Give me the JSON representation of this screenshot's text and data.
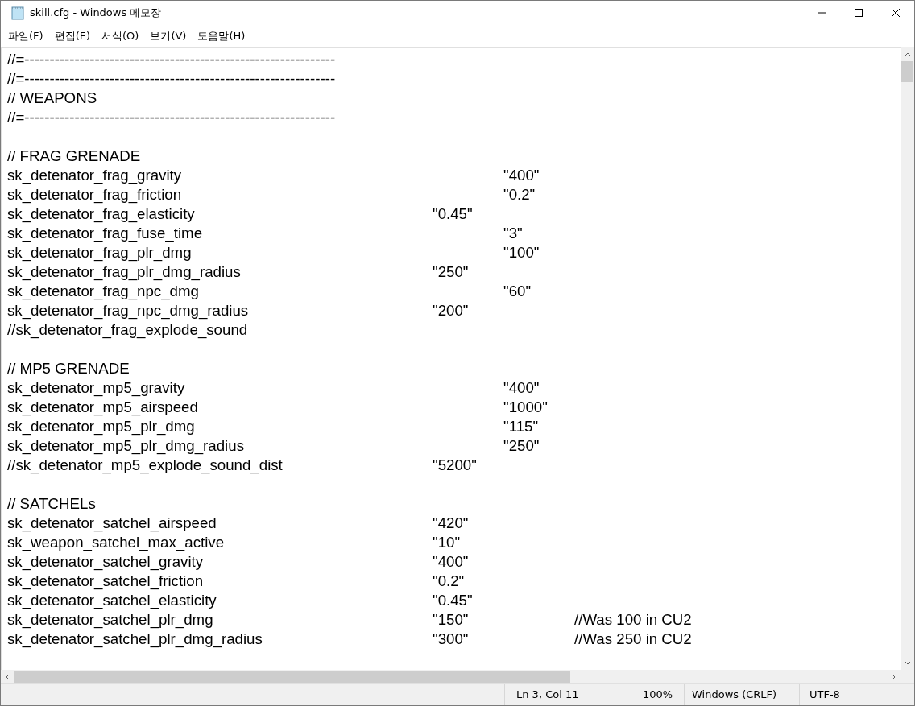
{
  "window": {
    "title": "skill.cfg - Windows 메모장"
  },
  "menu": [
    "파일(F)",
    "편집(E)",
    "서식(O)",
    "보기(V)",
    "도움말(H)"
  ],
  "editor": {
    "lines": [
      {
        "kind": "text",
        "text": "//=--------------------------------------------------------------"
      },
      {
        "kind": "text",
        "text": "//=--------------------------------------------------------------"
      },
      {
        "kind": "text",
        "text": "// WEAPONS"
      },
      {
        "kind": "text",
        "text": "//=--------------------------------------------------------------"
      },
      {
        "kind": "blank"
      },
      {
        "kind": "text",
        "text": "// FRAG GRENADE"
      },
      {
        "kind": "text",
        "text": "sk_detenator_frag_gravity\t\t\t\t\t\"400\""
      },
      {
        "kind": "text",
        "text": "sk_detenator_frag_friction\t\t\t\t\t\"0.2\""
      },
      {
        "kind": "text",
        "text": "sk_detenator_frag_elasticity\t\t\t\t\"0.45\""
      },
      {
        "kind": "text",
        "text": "sk_detenator_frag_fuse_time\t\t\t\t\t\"3\""
      },
      {
        "kind": "text",
        "text": "sk_detenator_frag_plr_dmg\t\t\t\t\t\"100\""
      },
      {
        "kind": "text",
        "text": "sk_detenator_frag_plr_dmg_radius\t\t\t\"250\""
      },
      {
        "kind": "text",
        "text": "sk_detenator_frag_npc_dmg\t\t\t\t\t\"60\""
      },
      {
        "kind": "text",
        "text": "sk_detenator_frag_npc_dmg_radius\t\t\t\"200\""
      },
      {
        "kind": "text",
        "text": "//sk_detenator_frag_explode_sound"
      },
      {
        "kind": "blank"
      },
      {
        "kind": "text",
        "text": "// MP5 GRENADE"
      },
      {
        "kind": "text",
        "text": "sk_detenator_mp5_gravity\t\t\t\t\t\"400\""
      },
      {
        "kind": "text",
        "text": "sk_detenator_mp5_airspeed\t\t\t\t\t\"1000\""
      },
      {
        "kind": "text",
        "text": "sk_detenator_mp5_plr_dmg\t\t\t\t\t\"115\""
      },
      {
        "kind": "text",
        "text": "sk_detenator_mp5_plr_dmg_radius\t\t\t\t\"250\""
      },
      {
        "kind": "text",
        "text": "//sk_detenator_mp5_explode_sound_dist\t\t\t\"5200\""
      },
      {
        "kind": "blank"
      },
      {
        "kind": "text",
        "text": "// SATCHELs"
      },
      {
        "kind": "text",
        "text": "sk_detenator_satchel_airspeed\t\t\t\t\"420\""
      },
      {
        "kind": "text",
        "text": "sk_weapon_satchel_max_active\t\t\t\"10\""
      },
      {
        "kind": "text",
        "text": "sk_detenator_satchel_gravity\t\t\t\t\"400\""
      },
      {
        "kind": "text",
        "text": "sk_detenator_satchel_friction\t\t\t\t\"0.2\""
      },
      {
        "kind": "text",
        "text": "sk_detenator_satchel_elasticity\t\t\t\t\"0.45\""
      },
      {
        "kind": "text",
        "text": "sk_detenator_satchel_plr_dmg\t\t\t\t\"150\"\t\t//Was 100 in CU2"
      },
      {
        "kind": "text",
        "text": "sk_detenator_satchel_plr_dmg_radius\t\t\t\"300\"\t\t//Was 250 in CU2"
      }
    ]
  },
  "status_bar": {
    "position": "Ln 3, Col 11",
    "zoom": "100%",
    "line_ending": "Windows (CRLF)",
    "encoding": "UTF-8"
  }
}
